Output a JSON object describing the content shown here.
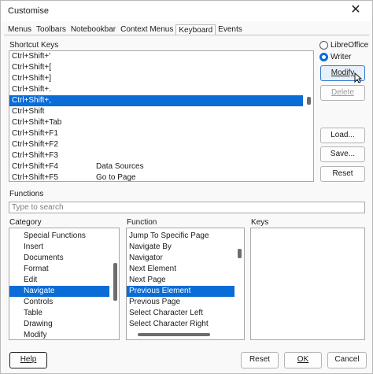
{
  "window": {
    "title": "Customise"
  },
  "tabs": [
    {
      "label": "Menus",
      "active": false
    },
    {
      "label": "Toolbars",
      "active": false
    },
    {
      "label": "Notebookbar",
      "active": false
    },
    {
      "label": "Context Menus",
      "active": false
    },
    {
      "label": "Keyboard",
      "active": true
    },
    {
      "label": "Events",
      "active": false
    }
  ],
  "shortcut_keys": {
    "label": "Shortcut Keys",
    "rows": [
      {
        "key": "Ctrl+Shift+'",
        "function": ""
      },
      {
        "key": "Ctrl+Shift+[",
        "function": ""
      },
      {
        "key": "Ctrl+Shift+]",
        "function": ""
      },
      {
        "key": "Ctrl+Shift+.",
        "function": ""
      },
      {
        "key": "Ctrl+Shift+,",
        "function": "",
        "selected": true
      },
      {
        "key": "Ctrl+Shift",
        "function": ""
      },
      {
        "key": "Ctrl+Shift+Tab",
        "function": ""
      },
      {
        "key": "Ctrl+Shift+F1",
        "function": ""
      },
      {
        "key": "Ctrl+Shift+F2",
        "function": ""
      },
      {
        "key": "Ctrl+Shift+F3",
        "function": ""
      },
      {
        "key": "Ctrl+Shift+F4",
        "function": "Data Sources"
      },
      {
        "key": "Ctrl+Shift+F5",
        "function": "Go to Page"
      }
    ]
  },
  "scope": {
    "options": [
      {
        "label": "LibreOffice",
        "checked": false
      },
      {
        "label": "Writer",
        "checked": true
      }
    ]
  },
  "buttons": {
    "modify": "Modify",
    "delete": "Delete",
    "load": "Load...",
    "save": "Save...",
    "reset_keys": "Reset",
    "help": "Help",
    "reset": "Reset",
    "ok": "OK",
    "cancel": "Cancel"
  },
  "functions": {
    "label": "Functions",
    "search_placeholder": "Type to search"
  },
  "category": {
    "label": "Category",
    "items": [
      {
        "label": "Special Functions"
      },
      {
        "label": "Insert"
      },
      {
        "label": "Documents"
      },
      {
        "label": "Format"
      },
      {
        "label": "Edit"
      },
      {
        "label": "Navigate",
        "selected": true
      },
      {
        "label": "Controls"
      },
      {
        "label": "Table"
      },
      {
        "label": "Drawing"
      },
      {
        "label": "Modify"
      }
    ]
  },
  "function": {
    "label": "Function",
    "items": [
      {
        "label": "Jump To Specific Page"
      },
      {
        "label": "Navigate By"
      },
      {
        "label": "Navigator"
      },
      {
        "label": "Next Element"
      },
      {
        "label": "Next Page"
      },
      {
        "label": "Previous Element",
        "selected": true
      },
      {
        "label": "Previous Page"
      },
      {
        "label": "Select Character Left"
      },
      {
        "label": "Select Character Right"
      }
    ]
  },
  "keys": {
    "label": "Keys",
    "items": []
  },
  "colors": {
    "accent": "#0a6cd6"
  }
}
